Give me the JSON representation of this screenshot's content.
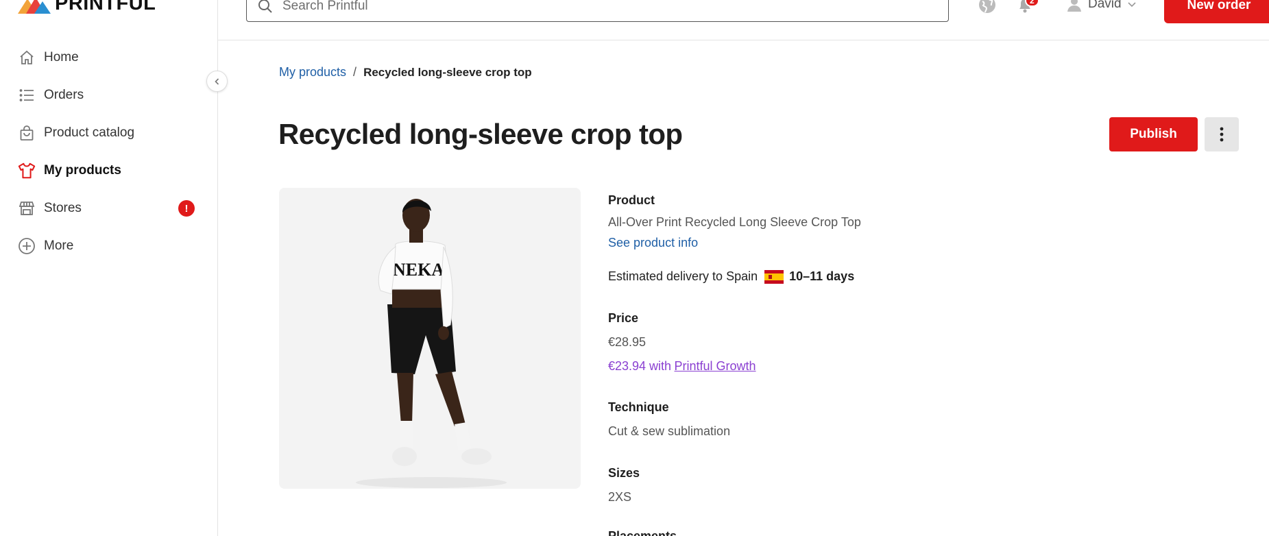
{
  "app": {
    "brand": "PRINTFUL",
    "brand_colors": {
      "red": "#e01a1a",
      "link": "#1f5fa6",
      "growth": "#8a3fd1"
    }
  },
  "sidebar": {
    "items": [
      {
        "label": "Home",
        "icon": "home-icon"
      },
      {
        "label": "Orders",
        "icon": "list-icon"
      },
      {
        "label": "Product catalog",
        "icon": "shopping-bag-icon"
      },
      {
        "label": "My products",
        "icon": "tshirt-icon",
        "active": true
      },
      {
        "label": "Stores",
        "icon": "store-icon",
        "alert": "!"
      },
      {
        "label": "More",
        "icon": "plus-circle-icon"
      }
    ]
  },
  "topbar": {
    "search_placeholder": "Search Printful",
    "notifications_count": "2",
    "user_name": "David",
    "new_order_label": "New order"
  },
  "breadcrumb": {
    "parent": "My products",
    "separator": "/",
    "current": "Recycled long-sleeve crop top"
  },
  "page": {
    "title": "Recycled long-sleeve crop top",
    "publish_label": "Publish"
  },
  "product": {
    "product_label": "Product",
    "product_name": "All-Over Print Recycled Long Sleeve Crop Top",
    "see_info": "See product info",
    "delivery_text": "Estimated delivery to Spain",
    "delivery_days": "10–11 days",
    "price_label": "Price",
    "price": "€28.95",
    "growth_price": "€23.94 with",
    "growth_link": "Printful Growth",
    "technique_label": "Technique",
    "technique": "Cut & sew sublimation",
    "sizes_label": "Sizes",
    "sizes": "2XS",
    "placements_label": "Placements"
  }
}
